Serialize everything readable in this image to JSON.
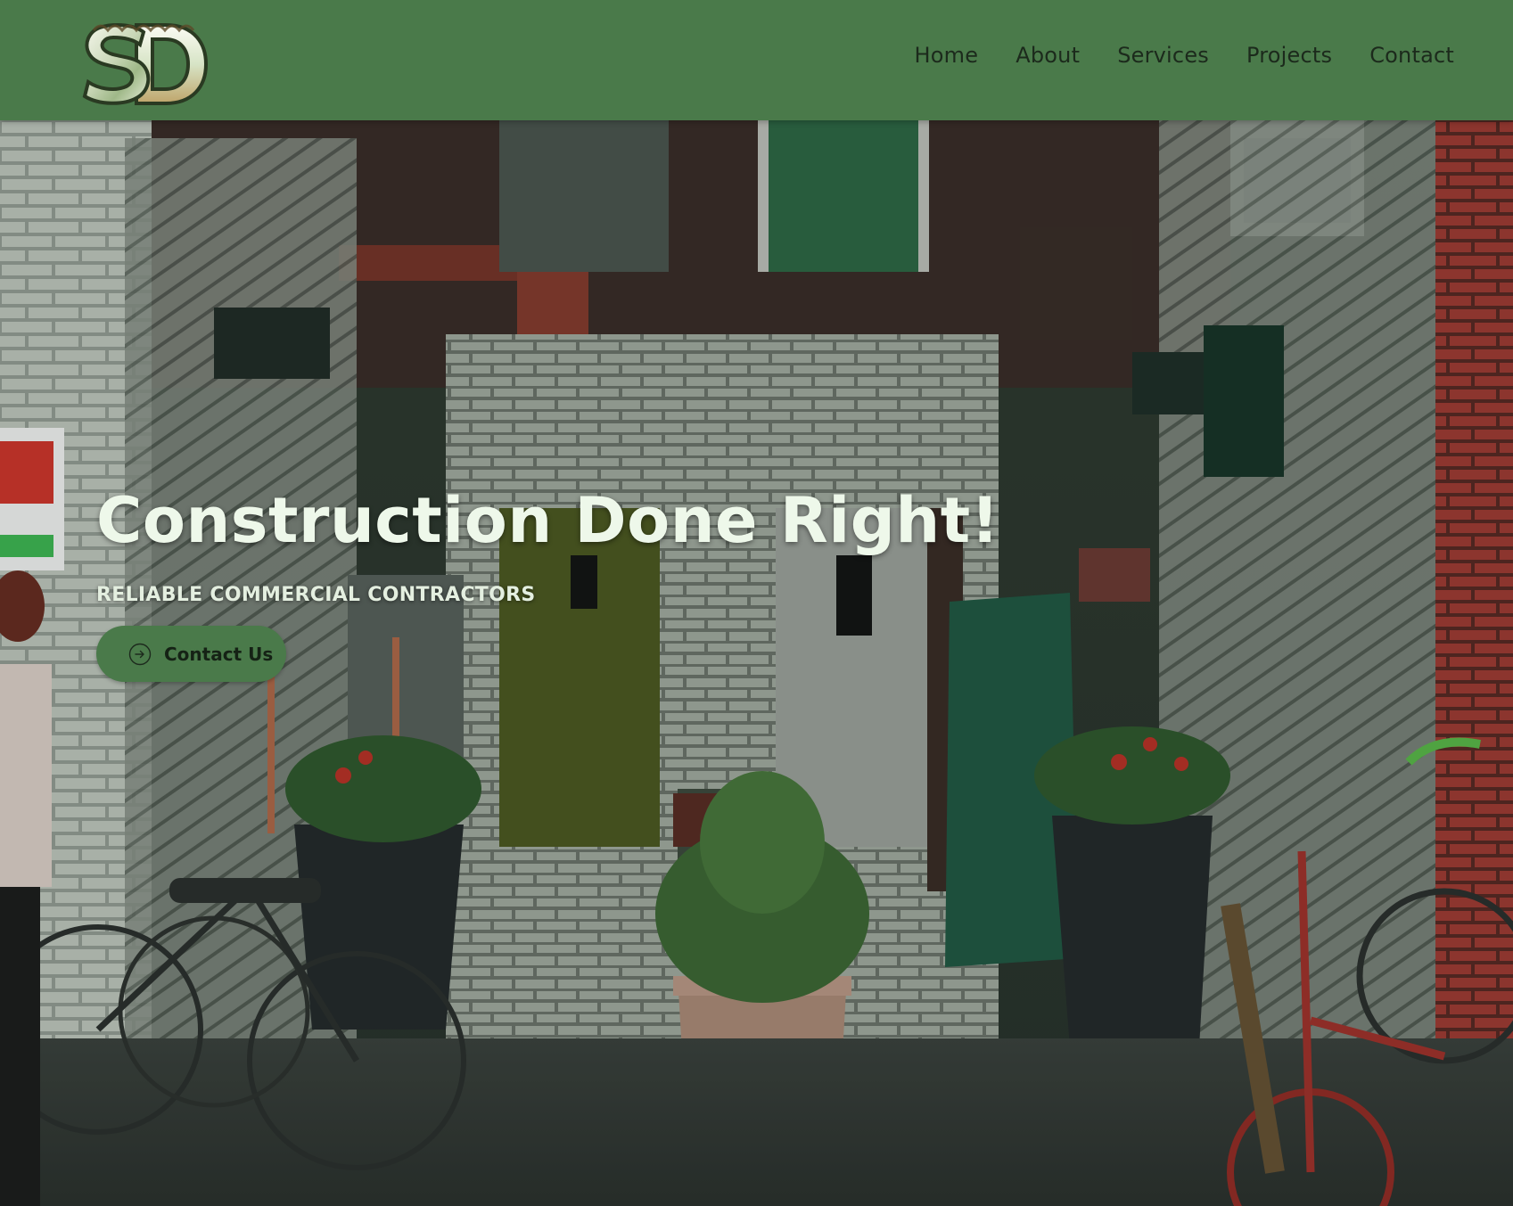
{
  "header": {
    "logo_alt": "SD",
    "nav": [
      {
        "label": "Home"
      },
      {
        "label": "About"
      },
      {
        "label": "Services"
      },
      {
        "label": "Projects"
      },
      {
        "label": "Contact"
      }
    ]
  },
  "hero": {
    "title": "Construction Done Right!",
    "subtitle": "RELIABLE COMMERCIAL CONTRACTORS",
    "cta_label": "Contact Us",
    "cta_icon": "arrow-right-circle-icon"
  },
  "colors": {
    "header_bg": "#4a7a4a",
    "button_bg": "#4a7a4a",
    "title_text": "#eef8ea",
    "nav_text": "#1c2a1c"
  }
}
